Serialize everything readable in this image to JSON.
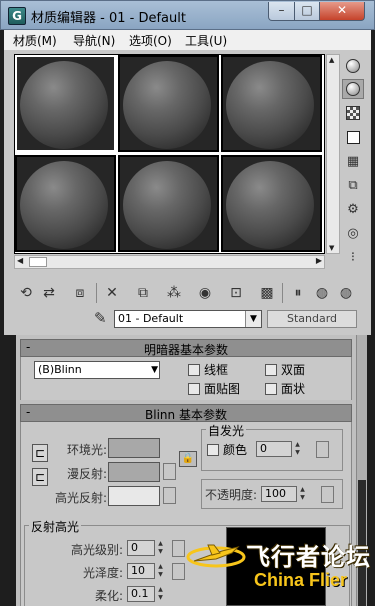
{
  "window": {
    "title": "材质编辑器 - 01 - Default",
    "app_icon_letter": "G",
    "minimize": "–",
    "maximize": "□",
    "close": "✕"
  },
  "menu": [
    "材质(M)",
    "导航(N)",
    "选项(O)",
    "工具(U)"
  ],
  "material": {
    "name": "01 - Default",
    "type_button": "Standard"
  },
  "shader_rollout": {
    "title": "明暗器基本参数",
    "collapse": "-",
    "shader": "(B)Blinn",
    "wire": "线框",
    "two_sided": "双面",
    "face_map": "面贴图",
    "faceted": "面状"
  },
  "blinn_rollout": {
    "title": "Blinn 基本参数",
    "collapse": "-",
    "ambient": "环境光:",
    "diffuse": "漫反射:",
    "specular": "高光反射:",
    "self_illum_title": "自发光",
    "color_label": "颜色",
    "color_value": "0",
    "opacity_label": "不透明度:",
    "opacity_value": "100",
    "lock_glyph": "🔒",
    "bracket_glyph": "⊏",
    "spec_highlights_title": "反射高光",
    "specular_level": "高光级别:",
    "specular_level_value": "0",
    "glossiness": "光泽度:",
    "glossiness_value": "10",
    "soften": "柔化:",
    "soften_value": "0.1"
  },
  "watermark": {
    "cn": "飞行者论坛",
    "en": "China Flier"
  },
  "colors": {
    "ambient": "#a8a8a8",
    "diffuse": "#a8a8a8",
    "specular": "#e8e8e8",
    "active_slot_border": "#ffffff"
  },
  "icons": {
    "sample_type": "sphere-icon",
    "backlight": "backlight-icon",
    "background": "checker-background-icon",
    "uv_tiling": "uv-tiling-icon",
    "video_check": "video-color-check-icon",
    "make_preview": "make-preview-icon",
    "options": "options-icon",
    "select_by_material": "select-by-material-icon",
    "material_map_navigator": "material-map-navigator-icon"
  }
}
